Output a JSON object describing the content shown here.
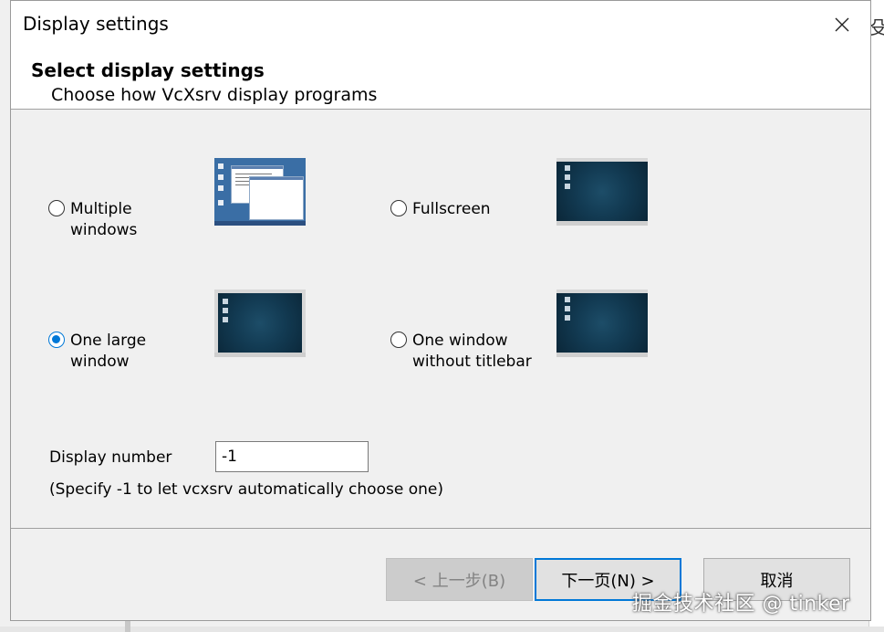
{
  "window": {
    "title": "Display settings"
  },
  "header": {
    "title": "Select display settings",
    "subtitle": "Choose how VcXsrv display programs"
  },
  "options": {
    "multiple_windows": {
      "label": "Multiple windows",
      "selected": false
    },
    "fullscreen": {
      "label": "Fullscreen",
      "selected": false
    },
    "one_large_window": {
      "label": "One large window",
      "selected": true
    },
    "one_window_no_titlebar": {
      "label": "One window without titlebar",
      "selected": false
    }
  },
  "display_number": {
    "label": "Display number",
    "value": "-1",
    "hint": "(Specify -1 to let vcxsrv automatically choose one)"
  },
  "buttons": {
    "back": "< 上一步(B)",
    "next": "下一页(N) >",
    "cancel": "取消"
  },
  "watermark": "掘金技术社区 @ tinker",
  "background_fragment": "殳",
  "colors": {
    "accent": "#0078d7",
    "thumbnail_bg": "#123a52",
    "thumbnail_multi_bg": "#3a6ea5"
  },
  "icons": {
    "close": "close-icon"
  }
}
